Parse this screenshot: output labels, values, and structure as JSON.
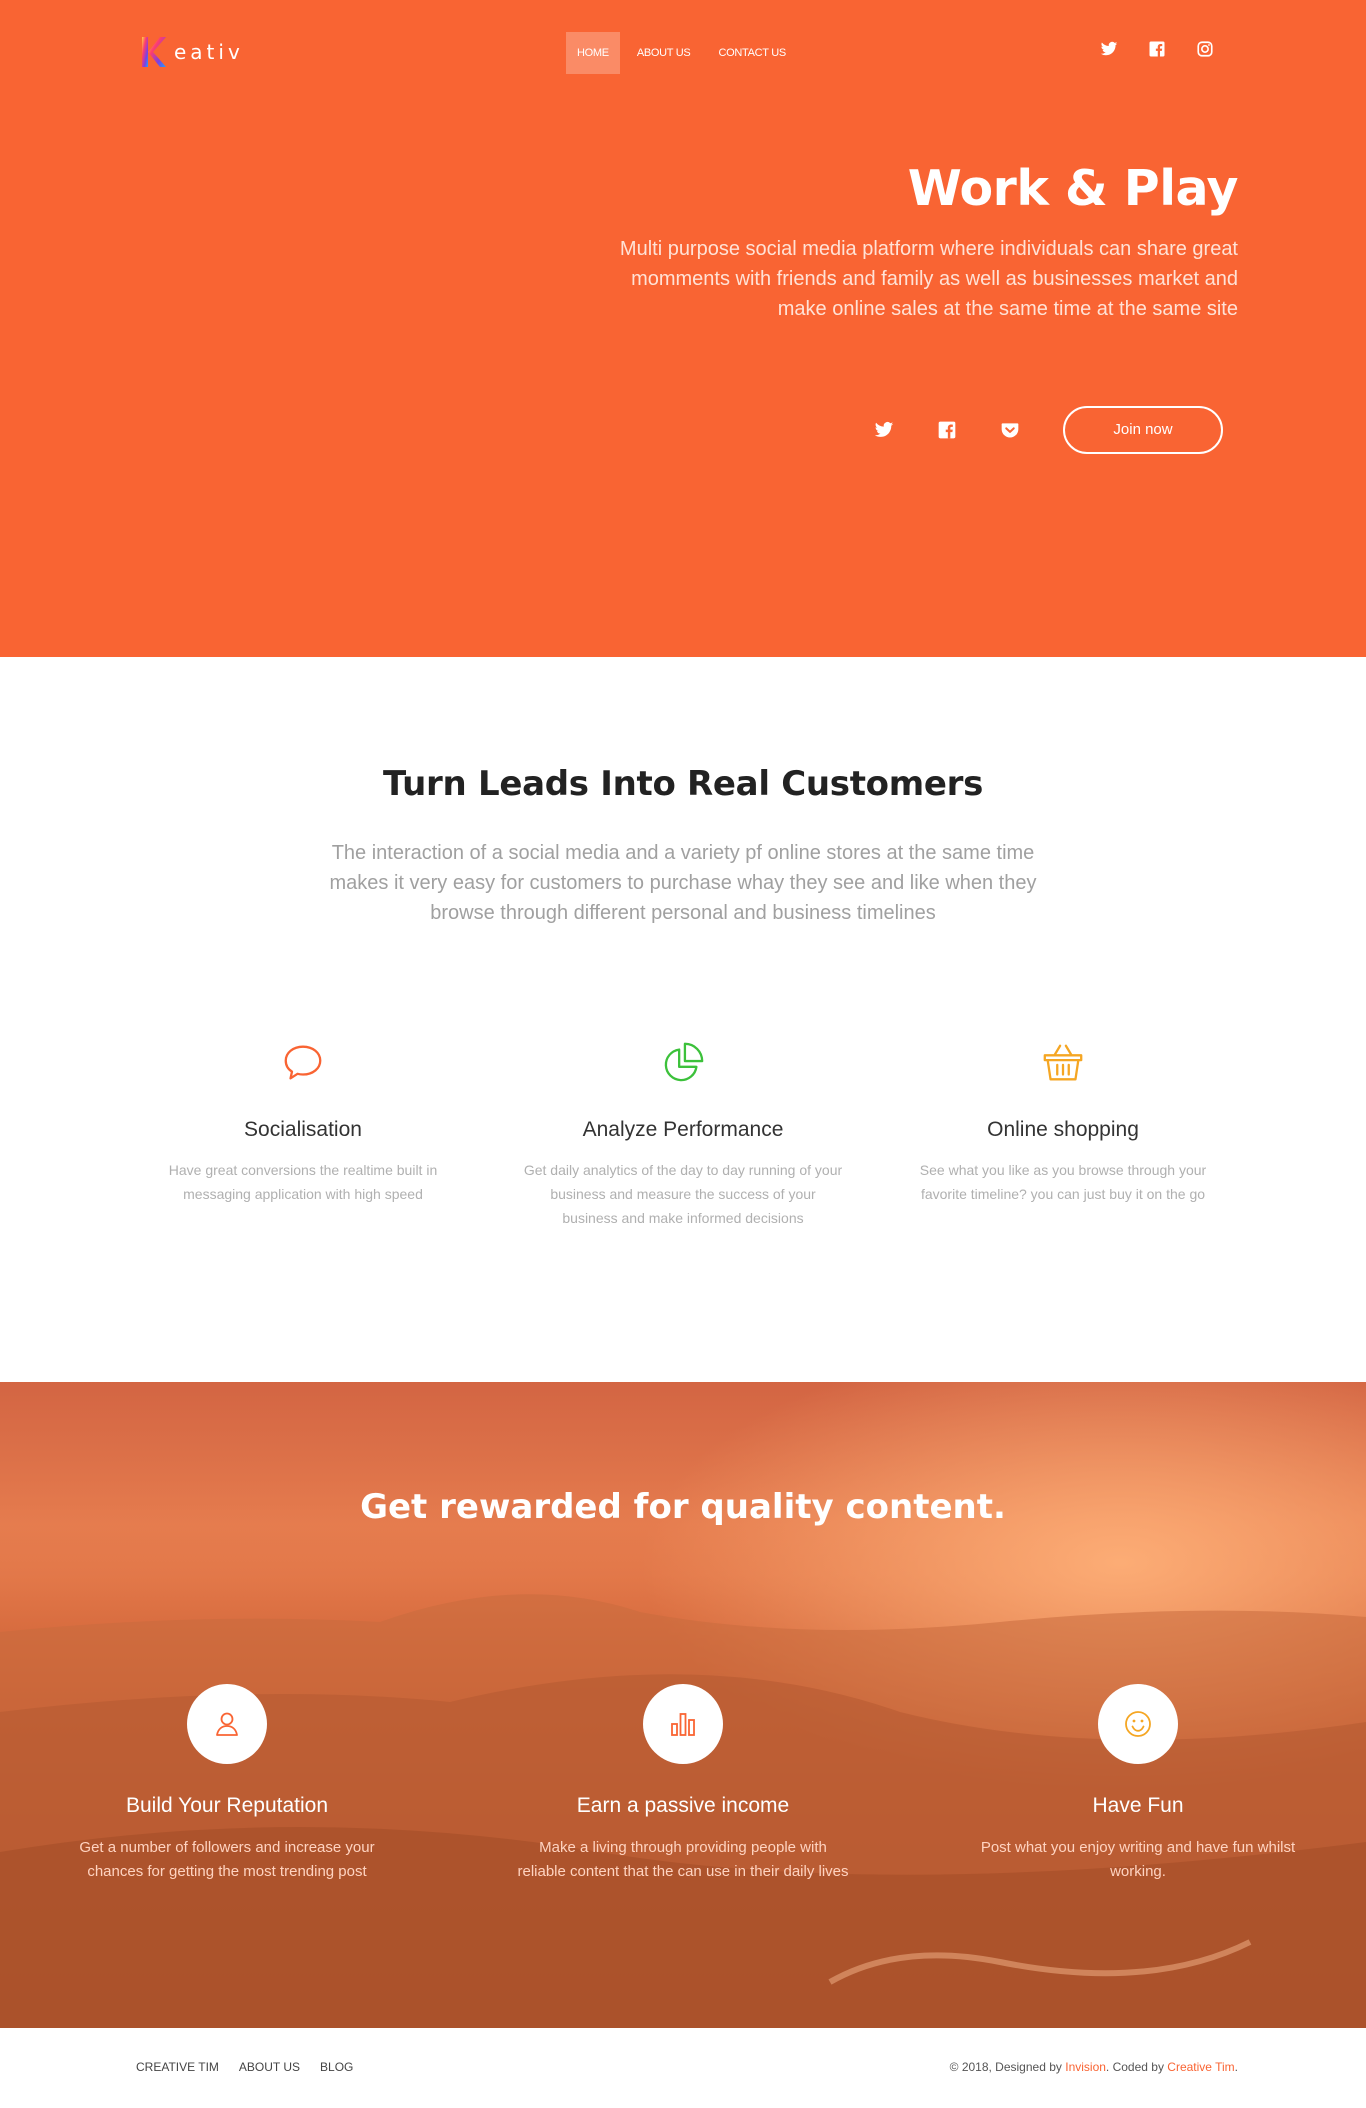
{
  "brand": {
    "name": "eativ",
    "accent": "#f96433"
  },
  "nav": {
    "items": [
      {
        "label": "HOME",
        "active": true
      },
      {
        "label": "ABOUT US",
        "active": false
      },
      {
        "label": "CONTACT US",
        "active": false
      }
    ]
  },
  "top_social": [
    "twitter-icon",
    "facebook-icon",
    "instagram-icon"
  ],
  "hero": {
    "title": "Work & Play",
    "description": "Multi purpose social media platform where individuals can share great momments with friends and family as well as businesses market and make online sales at the same time at the same site",
    "social": [
      "twitter-icon",
      "facebook-icon",
      "pocket-icon"
    ],
    "cta": "Join now"
  },
  "leads": {
    "title": "Turn Leads Into Real Customers",
    "description": "The interaction of a social media and a variety pf online stores at the same time makes it very easy for customers to purchase whay they see and like when they browse through different personal and business timelines",
    "features": [
      {
        "icon": "chat-bubble-icon",
        "color": "#f96433",
        "title": "Socialisation",
        "text": "Have great conversions the realtime built in messaging application with high speed"
      },
      {
        "icon": "pie-chart-icon",
        "color": "#3cc13b",
        "title": "Analyze Performance",
        "text": "Get daily analytics of the day to day running of your business and measure the success of your business and make informed decisions"
      },
      {
        "icon": "basket-icon",
        "color": "#f5a623",
        "title": "Online shopping",
        "text": "See what you like as you browse through your favorite timeline? you can just buy it on the go"
      }
    ]
  },
  "rewards": {
    "title": "Get rewarded for quality content.",
    "items": [
      {
        "icon": "user-icon",
        "title": "Build Your Reputation",
        "text": "Get a number of followers and increase your chances for getting the most trending post"
      },
      {
        "icon": "bar-chart-icon",
        "title": "Earn a passive income",
        "text": "Make a living through providing people with reliable content that the can use in their daily lives"
      },
      {
        "icon": "smiley-icon",
        "title": "Have Fun",
        "text": "Post what you enjoy writing and have fun whilst working."
      }
    ]
  },
  "footer": {
    "links": [
      "CREATIVE TIM",
      "ABOUT US",
      "BLOG"
    ],
    "copyright_prefix": "© 2018, Designed by ",
    "designer": "Invision",
    "copyright_mid": ". Coded by ",
    "coder": "Creative Tim",
    "copyright_suffix": "."
  }
}
